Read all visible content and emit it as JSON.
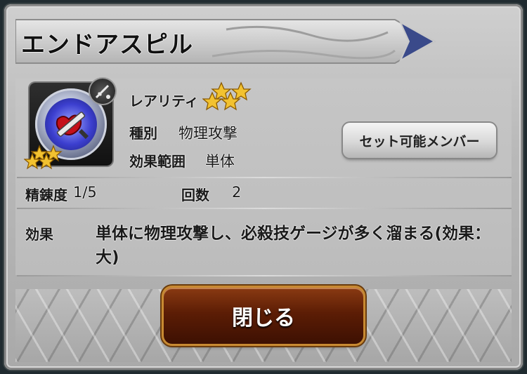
{
  "title": "エンドアスピル",
  "rarity": {
    "label": "レアリティ",
    "stars": 3
  },
  "icon_stars": 3,
  "type": {
    "label": "種別",
    "value": "物理攻撃"
  },
  "range": {
    "label": "効果範囲",
    "value": "単体"
  },
  "refine": {
    "label": "精錬度",
    "value": "1/5"
  },
  "count": {
    "label": "回数",
    "value": "2"
  },
  "effect": {
    "label": "効果",
    "text": "単体に物理攻撃し、必殺技ゲージが多く溜まる(効果：大)"
  },
  "buttons": {
    "set_members": "セット可能メンバー",
    "close": "閉じる"
  },
  "colors": {
    "star_gold": "#f2c230",
    "close_button": "#5c1d05",
    "frame": "#b9b9b9"
  }
}
